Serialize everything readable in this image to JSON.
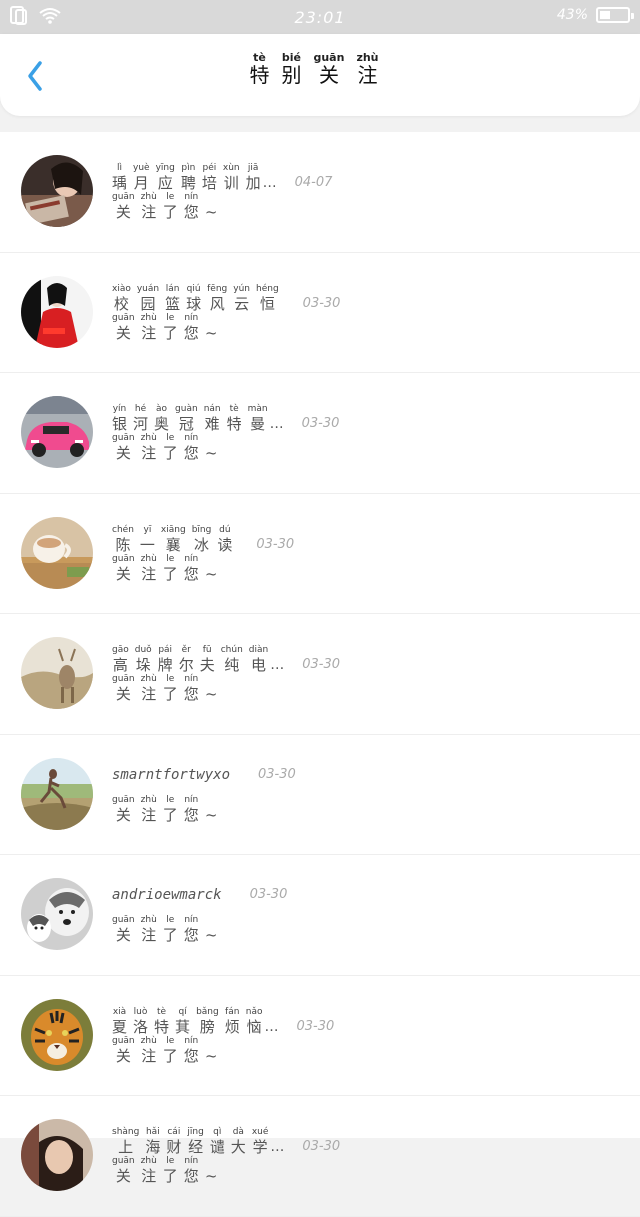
{
  "status_bar": {
    "time": "23:01",
    "battery": "43%"
  },
  "header": {
    "title": [
      {
        "py": "tè",
        "hz": "特"
      },
      {
        "py": "bié",
        "hz": "别"
      },
      {
        "py": "guān",
        "hz": "关"
      },
      {
        "py": "zhù",
        "hz": "注"
      }
    ]
  },
  "followed_message": [
    {
      "py": "guān",
      "hz": "关"
    },
    {
      "py": "zhù",
      "hz": "注"
    },
    {
      "py": "le",
      "hz": "了"
    },
    {
      "py": "nín",
      "hz": "您"
    },
    {
      "py": "",
      "hz": "~"
    }
  ],
  "items": [
    {
      "avatar": "woman-reading",
      "date": "04-07",
      "ellipsis": "…",
      "name": [
        {
          "py": "lì",
          "hz": "瑀"
        },
        {
          "py": "yuè",
          "hz": "月"
        },
        {
          "py": "yīng",
          "hz": "应"
        },
        {
          "py": "pìn",
          "hz": "聘"
        },
        {
          "py": "péi",
          "hz": "培"
        },
        {
          "py": "xùn",
          "hz": "训"
        },
        {
          "py": "jiā",
          "hz": "加"
        }
      ]
    },
    {
      "avatar": "woman-red-dress",
      "date": "03-30",
      "ellipsis": "",
      "name": [
        {
          "py": "xiào",
          "hz": "校"
        },
        {
          "py": "yuán",
          "hz": "园"
        },
        {
          "py": "lán",
          "hz": "篮"
        },
        {
          "py": "qiú",
          "hz": "球"
        },
        {
          "py": "fēng",
          "hz": "风"
        },
        {
          "py": "yún",
          "hz": "云"
        },
        {
          "py": "héng",
          "hz": "恒"
        }
      ]
    },
    {
      "avatar": "pink-sports-car",
      "date": "03-30",
      "ellipsis": "…",
      "name": [
        {
          "py": "yín",
          "hz": "银"
        },
        {
          "py": "hé",
          "hz": "河"
        },
        {
          "py": "ào",
          "hz": "奥"
        },
        {
          "py": "guàn",
          "hz": "冠"
        },
        {
          "py": "nán",
          "hz": "难"
        },
        {
          "py": "tè",
          "hz": "特"
        },
        {
          "py": "màn",
          "hz": "曼"
        }
      ]
    },
    {
      "avatar": "tea-cup",
      "date": "03-30",
      "ellipsis": "",
      "name": [
        {
          "py": "chén",
          "hz": "陈"
        },
        {
          "py": "yī",
          "hz": "一"
        },
        {
          "py": "xiāng",
          "hz": "襄"
        },
        {
          "py": "bīng",
          "hz": "冰"
        },
        {
          "py": "dú",
          "hz": "读"
        }
      ]
    },
    {
      "avatar": "deer-field",
      "date": "03-30",
      "ellipsis": "…",
      "name": [
        {
          "py": "gāo",
          "hz": "高"
        },
        {
          "py": "duǒ",
          "hz": "垛"
        },
        {
          "py": "pái",
          "hz": "牌"
        },
        {
          "py": "ěr",
          "hz": "尔"
        },
        {
          "py": "fū",
          "hz": "夫"
        },
        {
          "py": "chún",
          "hz": "纯"
        },
        {
          "py": "diàn",
          "hz": "电"
        }
      ]
    },
    {
      "avatar": "runner",
      "date": "03-30",
      "ellipsis": "",
      "latin": "smarntfortwyxo"
    },
    {
      "avatar": "husky-dogs",
      "date": "03-30",
      "ellipsis": "",
      "latin": "andrioewmarck"
    },
    {
      "avatar": "tiger",
      "date": "03-30",
      "ellipsis": "…",
      "name": [
        {
          "py": "xià",
          "hz": "夏"
        },
        {
          "py": "luò",
          "hz": "洛"
        },
        {
          "py": "tè",
          "hz": "特"
        },
        {
          "py": "qí",
          "hz": "萁"
        },
        {
          "py": "bǎng",
          "hz": "膀"
        },
        {
          "py": "fán",
          "hz": "烦"
        },
        {
          "py": "nǎo",
          "hz": "恼"
        }
      ]
    },
    {
      "avatar": "portrait",
      "date": "03-30",
      "ellipsis": "…",
      "name": [
        {
          "py": "shàng",
          "hz": "上"
        },
        {
          "py": "hǎi",
          "hz": "海"
        },
        {
          "py": "cái",
          "hz": "财"
        },
        {
          "py": "jīng",
          "hz": "经"
        },
        {
          "py": "qì",
          "hz": "谴"
        },
        {
          "py": "dà",
          "hz": "大"
        },
        {
          "py": "xué",
          "hz": "学"
        }
      ]
    }
  ],
  "colors": {
    "accent": "#3aa0e6",
    "status_bar": "#d9d9d9",
    "date": "#aaaaaa"
  }
}
